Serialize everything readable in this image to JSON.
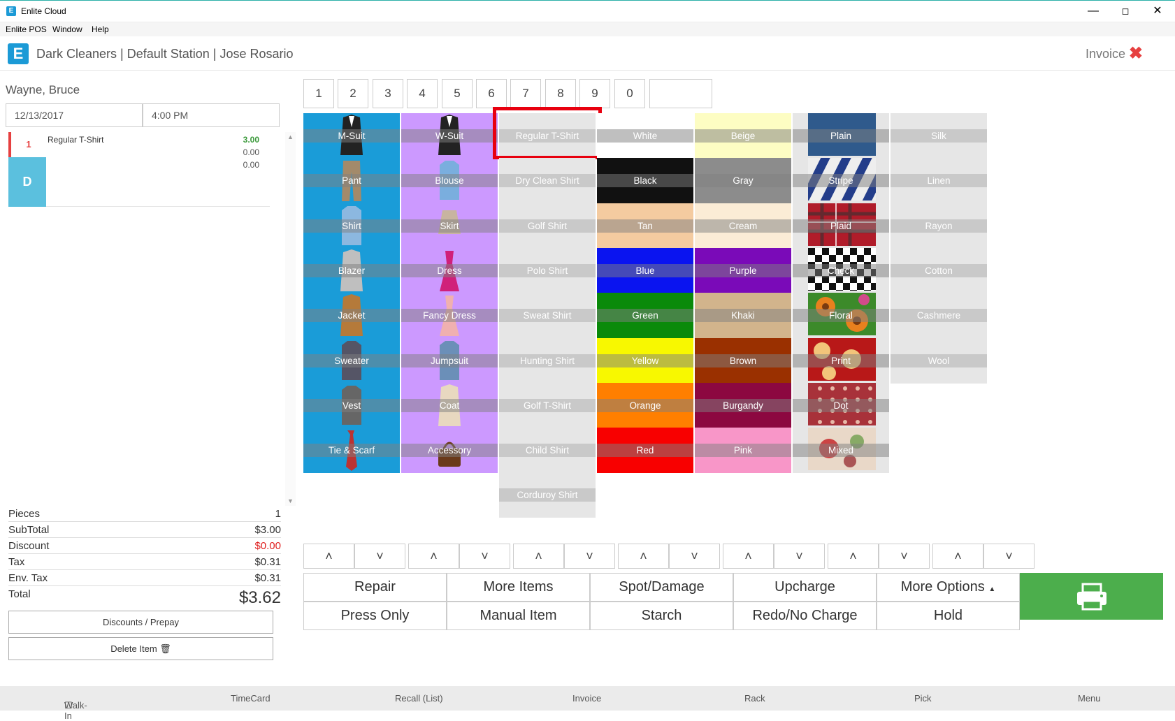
{
  "window": {
    "title": "Enlite Cloud",
    "logo_letter": "E"
  },
  "menubar": {
    "items": [
      "Enlite POS",
      "Window",
      "Help"
    ]
  },
  "header": {
    "logo_letter": "E",
    "title": "Dark Cleaners | Default Station | Jose Rosario",
    "mode_label": "Invoice"
  },
  "customer": {
    "name": "Wayne, Bruce",
    "date": "12/13/2017",
    "time": "4:00 PM"
  },
  "items": [
    {
      "qty": "1",
      "badge": "D",
      "name": "Regular T-Shirt",
      "price": "3.00",
      "line2": "0.00",
      "line3": "0.00"
    }
  ],
  "totals": {
    "pieces_label": "Pieces",
    "pieces": "1",
    "subtotal_label": "SubTotal",
    "subtotal": "$3.00",
    "discount_label": "Discount",
    "discount": "$0.00",
    "tax_label": "Tax",
    "tax": "$0.31",
    "envtax_label": "Env. Tax",
    "envtax": "$0.31",
    "total_label": "Total",
    "total": "$3.62"
  },
  "left_buttons": {
    "discounts": "Discounts / Prepay",
    "delete": "Delete Item"
  },
  "numpad": [
    "1",
    "2",
    "3",
    "4",
    "5",
    "6",
    "7",
    "8",
    "9",
    "0"
  ],
  "numpad_input": "",
  "garments": [
    "M-Suit",
    "Pant",
    "Shirt",
    "Blazer",
    "Jacket",
    "Sweater",
    "Vest",
    "Tie & Scarf"
  ],
  "womens": [
    "W-Suit",
    "Blouse",
    "Skirt",
    "Dress",
    "Fancy Dress",
    "Jumpsuit",
    "Coat",
    "Accessory"
  ],
  "shirts": [
    "Regular T-Shirt",
    "Dry Clean Shirt",
    "Golf Shirt",
    "Polo Shirt",
    "Sweat Shirt",
    "Hunting Shirt",
    "Golf T-Shirt",
    "Child Shirt",
    "Corduroy Shirt"
  ],
  "selected_shirt": "Regular T-Shirt",
  "colors1": [
    {
      "name": "White",
      "color": "#ffffff"
    },
    {
      "name": "Black",
      "color": "#111111"
    },
    {
      "name": "Tan",
      "color": "#f4cba0"
    },
    {
      "name": "Blue",
      "color": "#0a14f0"
    },
    {
      "name": "Green",
      "color": "#0a8a0a"
    },
    {
      "name": "Yellow",
      "color": "#f8f800"
    },
    {
      "name": "Orange",
      "color": "#ff7f00"
    },
    {
      "name": "Red",
      "color": "#f80000"
    }
  ],
  "colors2": [
    {
      "name": "Beige",
      "color": "#fdfdc3"
    },
    {
      "name": "Gray",
      "color": "#8c8c8c"
    },
    {
      "name": "Cream",
      "color": "#fbecd6"
    },
    {
      "name": "Purple",
      "color": "#7a0ab8"
    },
    {
      "name": "Khaki",
      "color": "#d2b48c"
    },
    {
      "name": "Brown",
      "color": "#9a3000"
    },
    {
      "name": "Burgandy",
      "color": "#8c0840"
    },
    {
      "name": "Pink",
      "color": "#f896c8"
    }
  ],
  "patterns": [
    "Plain",
    "Stripe",
    "Plaid",
    "Check",
    "Floral",
    "Print",
    "Dot",
    "Mixed"
  ],
  "fabrics": [
    "Silk",
    "Linen",
    "Rayon",
    "Cotton",
    "Cashmere",
    "Wool"
  ],
  "actions": {
    "repair": "Repair",
    "more_items": "More Items",
    "spot": "Spot/Damage",
    "upcharge": "Upcharge",
    "more_options": "More Options",
    "press_only": "Press Only",
    "manual_item": "Manual Item",
    "starch": "Starch",
    "redo": "Redo/No Charge",
    "hold": "Hold"
  },
  "bottombar": {
    "walkin": "Walk-In",
    "timecard": "TimeCard",
    "recall": "Recall (List)",
    "invoice": "Invoice",
    "rack": "Rack",
    "pick": "Pick",
    "menu": "Menu"
  }
}
